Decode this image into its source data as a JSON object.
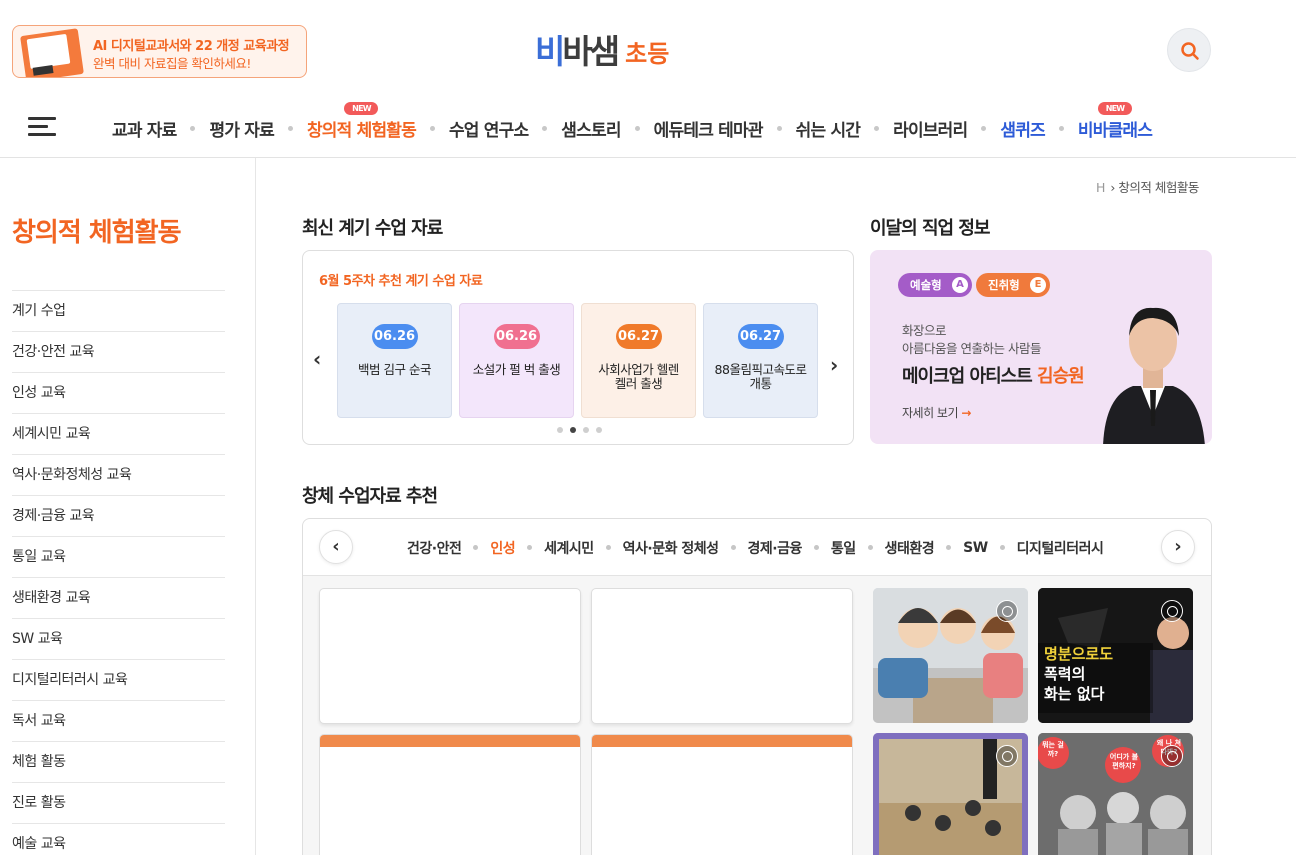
{
  "header": {
    "banner_line1": "AI 디지털교과서와 22 개정 교육과정",
    "banner_line2": "완벽 대비 자료집을 확인하세요!",
    "logo_main_a": "비",
    "logo_main_b": "바샘",
    "logo_sub": "초등"
  },
  "nav": {
    "items": [
      {
        "label": "교과 자료"
      },
      {
        "label": "평가 자료"
      },
      {
        "label": "창의적 체험활동",
        "badge": "NEW",
        "active": true
      },
      {
        "label": "수업 연구소"
      },
      {
        "label": "샘스토리"
      },
      {
        "label": "에듀테크 테마관"
      },
      {
        "label": "쉬는 시간"
      },
      {
        "label": "라이브러리"
      },
      {
        "label": "샘퀴즈"
      },
      {
        "label": "비바클래스",
        "badge": "NEW"
      }
    ],
    "badge": "NEW"
  },
  "breadcrumb": {
    "home": "H",
    "current": "창의적 체험활동"
  },
  "sidebar": {
    "title": "창의적 체험활동",
    "items": [
      "계기 수업",
      "건강·안전 교육",
      "인성 교육",
      "세계시민 교육",
      "역사·문화정체성 교육",
      "경제·금융 교육",
      "통일 교육",
      "생태환경 교육",
      "SW 교육",
      "디지털리터러시 교육",
      "독서 교육",
      "체험 활동",
      "진로 활동",
      "예술 교육"
    ]
  },
  "latest": {
    "section_title": "최신 계기 수업 자료",
    "week_highlight": "6월 5주차",
    "week_rest": " 추천 계기 수업 자료",
    "cards": [
      {
        "date": "06.26",
        "title": "백범 김구 순국",
        "color": "#4b8df0",
        "bg": "#e8eef8"
      },
      {
        "date": "06.26",
        "title": "소설가 펄 벅 출생",
        "color": "#f07090",
        "bg": "#f3e6fb"
      },
      {
        "date": "06.27",
        "title": "사회사업가 헬렌 켈러 출생",
        "color": "#f07a2a",
        "bg": "#fdf0e7"
      },
      {
        "date": "06.27",
        "title": "88올림픽고속도로 개통",
        "color": "#4b8df0",
        "bg": "#e8eef8"
      }
    ]
  },
  "job": {
    "section_title": "이달의 직업 정보",
    "tag1": "예술형",
    "tag1_letter": "A",
    "tag2": "진취형",
    "tag2_letter": "E",
    "desc1": "화장으로",
    "desc2": "아름다움을 연출하는 사람들",
    "name_job": "메이크업 아티스트 ",
    "name_person": "김승원",
    "more": "자세히 보기",
    "more_arrow": "→"
  },
  "recommend": {
    "section_title": "창체 수업자료 추천",
    "tabs": [
      "건강·안전",
      "인성",
      "세계시민",
      "역사·문화 정체성",
      "경제·금융",
      "통일",
      "생태환경",
      "SW",
      "디지털리터러시"
    ],
    "active_tab": "인성",
    "thumb2_caption1": "명분으로도",
    "thumb2_caption2": "폭력의",
    "thumb2_caption3": "화는 없다",
    "thumb4_bubble1": "어디가 불편하지?",
    "thumb4_bubble2": "왜 나 쳐다봐?",
    "thumb4_bubble3": "뭐는 걸까?"
  },
  "colors": {
    "accent": "#f26522",
    "blue": "#2d5bd7"
  }
}
